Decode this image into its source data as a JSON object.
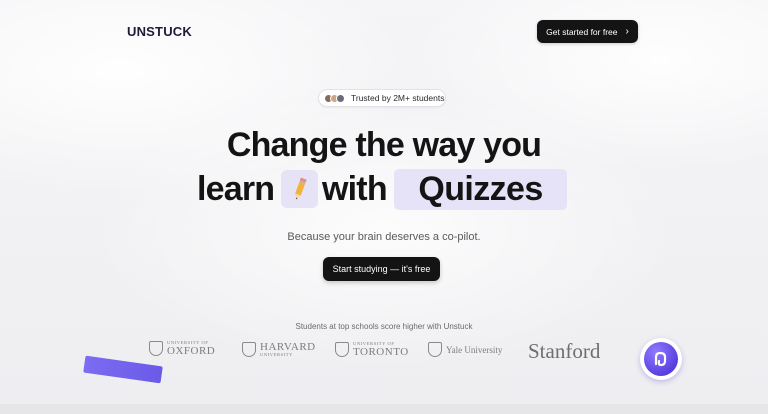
{
  "header": {
    "logo": "UNSTUCK",
    "cta_label": "Get started for free",
    "cta_icon": "chevron-right-icon"
  },
  "hero": {
    "trust_badge": "Trusted by 2M+ students",
    "headline_line1": "Change the way you",
    "headline_word_learn": "learn",
    "headline_icon": "pencil-icon",
    "headline_word_with": "with",
    "headline_highlight": "Quizzes",
    "subtitle": "Because your brain deserves a co-pilot.",
    "cta_label": "Start studying — it's free"
  },
  "schools": {
    "caption": "Students at top schools score higher with Unstuck",
    "logos": [
      {
        "top": "UNIVERSITY OF",
        "name": "OXFORD"
      },
      {
        "name": "HARVARD",
        "bottom": "UNIVERSITY"
      },
      {
        "top": "UNIVERSITY OF",
        "name": "TORONTO"
      },
      {
        "name": "Yale University"
      },
      {
        "name": "Stanford"
      }
    ]
  },
  "colors": {
    "accent": "#7c6cf2",
    "highlight_bg": "#e6e2f7",
    "button_bg": "#141414"
  }
}
